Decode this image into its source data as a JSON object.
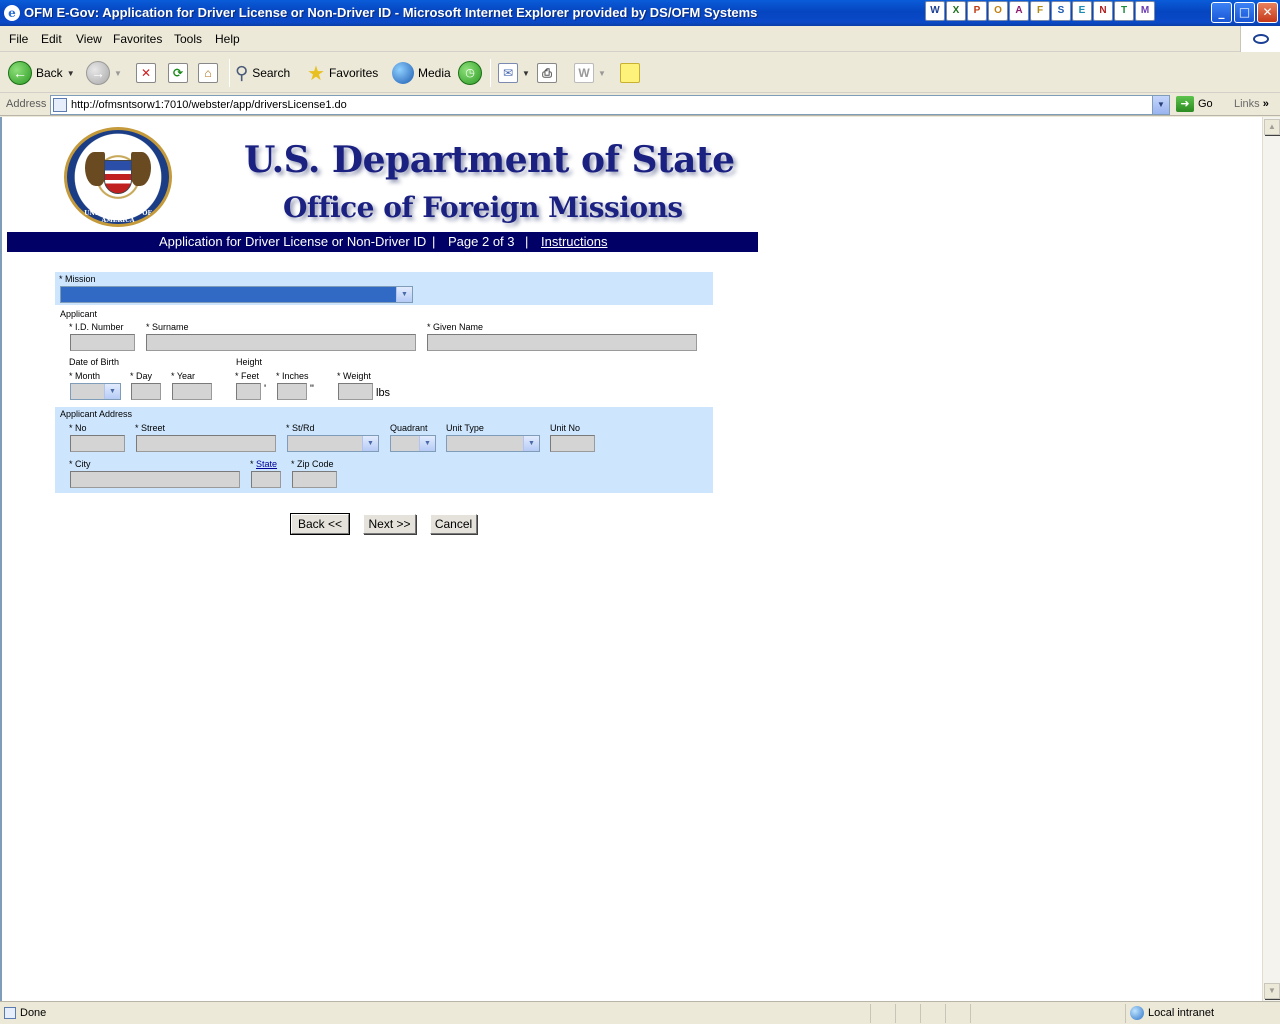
{
  "window": {
    "title": "OFM E-Gov: Application for Driver License or Non-Driver ID - Microsoft Internet Explorer provided by DS/OFM Systems",
    "min": "_",
    "max": "□",
    "close": "✕"
  },
  "tray_icons": [
    "W",
    "X",
    "P",
    "O",
    "A",
    "F",
    "S",
    "E",
    "N",
    "T",
    "M"
  ],
  "menu": [
    "File",
    "Edit",
    "View",
    "Favorites",
    "Tools",
    "Help"
  ],
  "toolbar": {
    "back": "Back",
    "search": "Search",
    "favorites": "Favorites",
    "media": "Media"
  },
  "address": {
    "label": "Address",
    "url": "http://ofmsntsorw1:7010/webster/app/driversLicense1.do",
    "go": "Go",
    "links": "Links"
  },
  "header": {
    "title": "U.S. Department of State",
    "subtitle": "Office of Foreign Missions",
    "seal_text": "UNITED STATES OF AMERICA",
    "nav_form": "Application for Driver License or Non-Driver ID",
    "nav_sep": "|",
    "nav_page": "Page 2 of 3",
    "nav_instructions": "Instructions"
  },
  "form": {
    "mission_label": "* Mission",
    "applicant_label": "Applicant",
    "id_number_label": "* I.D. Number",
    "surname_label": "* Surname",
    "given_name_label": "* Given Name",
    "dob_label": "Date of Birth",
    "height_label": "Height",
    "month_label": "* Month",
    "day_label": "* Day",
    "year_label": "* Year",
    "feet_label": "* Feet",
    "inches_label": "* Inches",
    "weight_label": "* Weight",
    "feet_unit": "'",
    "inches_unit": "\"",
    "weight_unit": "lbs",
    "address_label": "Applicant Address",
    "no_label": "* No",
    "street_label": "* Street",
    "strd_label": "* St/Rd",
    "quadrant_label": "Quadrant",
    "unit_type_label": "Unit Type",
    "unit_no_label": "Unit No",
    "city_label": "* City",
    "state_prefix": "*",
    "state_label": "State",
    "zip_label": "* Zip Code"
  },
  "buttons": {
    "back": "Back <<",
    "next": "Next >>",
    "cancel": "Cancel"
  },
  "status": {
    "text": "Done",
    "zone": "Local intranet"
  }
}
